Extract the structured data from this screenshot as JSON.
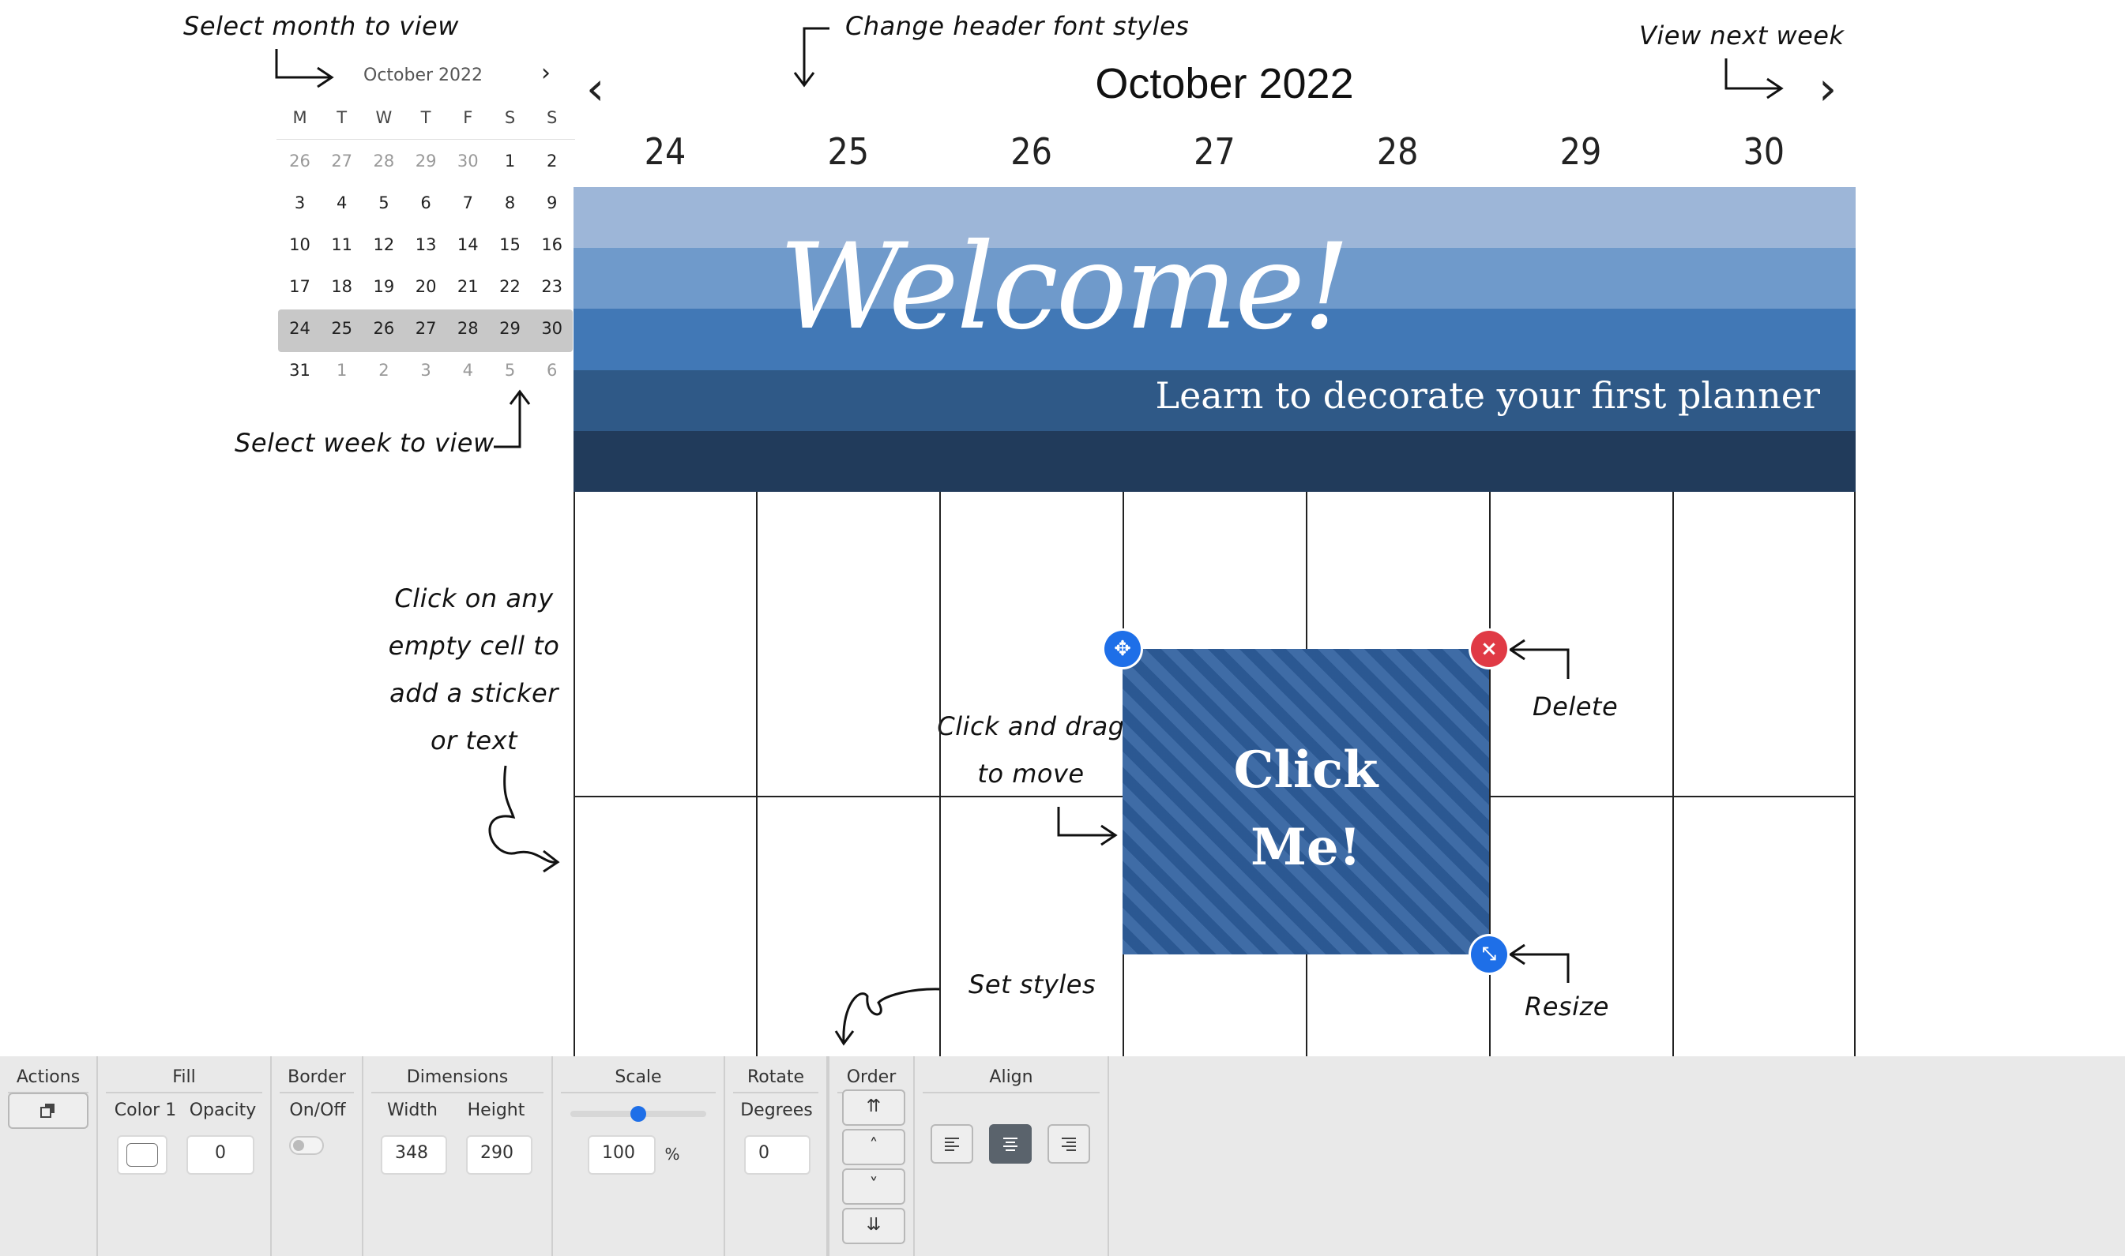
{
  "annotations": {
    "select_month": "Select month to view",
    "change_header": "Change header font styles",
    "view_next_week": "View next week",
    "select_week": "Select week to view",
    "click_empty_cell": [
      "Click on any",
      "empty cell to",
      "add a sticker",
      "or text"
    ],
    "click_drag": [
      "Click and drag",
      "to move"
    ],
    "delete": "Delete",
    "resize": "Resize",
    "set_styles": "Set styles"
  },
  "mini_calendar": {
    "month_label": "October 2022",
    "next_label": "›",
    "weekdays": [
      "M",
      "T",
      "W",
      "T",
      "F",
      "S",
      "S"
    ],
    "weeks": [
      [
        "26",
        "27",
        "28",
        "29",
        "30",
        "1",
        "2"
      ],
      [
        "3",
        "4",
        "5",
        "6",
        "7",
        "8",
        "9"
      ],
      [
        "10",
        "11",
        "12",
        "13",
        "14",
        "15",
        "16"
      ],
      [
        "17",
        "18",
        "19",
        "20",
        "21",
        "22",
        "23"
      ],
      [
        "24",
        "25",
        "26",
        "27",
        "28",
        "29",
        "30"
      ],
      [
        "31",
        "1",
        "2",
        "3",
        "4",
        "5",
        "6"
      ]
    ],
    "selected_week_index": 4
  },
  "header": {
    "month_title": "October 2022",
    "prev_label": "‹",
    "next_label": "›",
    "days": [
      "24",
      "25",
      "26",
      "27",
      "28",
      "29",
      "30"
    ]
  },
  "banner": {
    "title": "Welcome!",
    "subtitle": "Learn to decorate your first planner",
    "stripe_colors": [
      "#9db6d8",
      "#6f9acb",
      "#4178b6",
      "#2f5987",
      "#213b5b"
    ]
  },
  "sticker": {
    "line1": "Click",
    "line2": "Me!",
    "move_icon": "move-icon",
    "delete_icon": "close-icon",
    "resize_icon": "resize-icon",
    "colors": {
      "move": "#1e6fe8",
      "delete": "#e03a45",
      "resize": "#1e6fe8",
      "fill": "#2f5f9e"
    }
  },
  "toolbar": {
    "actions": {
      "title": "Actions",
      "icon": "duplicate-icon"
    },
    "fill": {
      "title": "Fill",
      "color_label": "Color 1",
      "opacity_label": "Opacity",
      "opacity_value": "0"
    },
    "border": {
      "title": "Border",
      "toggle_label": "On/Off",
      "enabled": false
    },
    "dimensions": {
      "title": "Dimensions",
      "width_label": "Width",
      "height_label": "Height",
      "width_value": "348",
      "height_value": "290"
    },
    "scale": {
      "title": "Scale",
      "value": "100",
      "unit": "%",
      "slider_level": 0.5
    },
    "rotate": {
      "title": "Rotate",
      "degrees_label": "Degrees",
      "degrees_value": "0"
    },
    "order": {
      "title": "Order",
      "buttons": [
        "bring-to-front-icon",
        "bring-forward-icon",
        "send-backward-icon",
        "send-to-back-icon"
      ]
    },
    "align": {
      "title": "Align",
      "buttons": [
        "align-left-icon",
        "align-center-icon",
        "align-right-icon"
      ],
      "active": "align-center-icon"
    }
  }
}
